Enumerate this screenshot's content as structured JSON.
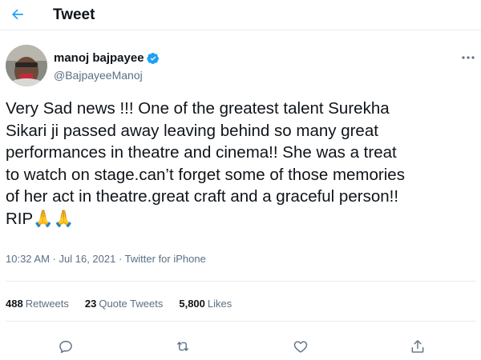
{
  "header": {
    "title": "Tweet",
    "back_icon": "arrow-left-icon"
  },
  "author": {
    "display_name": "manoj bajpayee",
    "handle": "@BajpayeeManoj",
    "verified": true
  },
  "tweet": {
    "text": "Very Sad news !!! One of the greatest talent Surekha\nSikari ji passed away leaving behind so many great\nperformances in theatre and cinema!! She was a treat\nto watch on stage.can’t forget some of those memories\nof her act in theatre.great craft and a graceful person!!\nRIP🙏🙏",
    "time": "10:32 AM",
    "date": "Jul 16, 2021",
    "source": "Twitter for iPhone",
    "separator": " · "
  },
  "stats": {
    "retweets_count": "488",
    "retweets_label": "Retweets",
    "quotes_count": "23",
    "quotes_label": "Quote Tweets",
    "likes_count": "5,800",
    "likes_label": "Likes"
  },
  "colors": {
    "accent": "#1da1f2",
    "secondary_text": "#5b7083",
    "divider": "#e8ebec"
  }
}
